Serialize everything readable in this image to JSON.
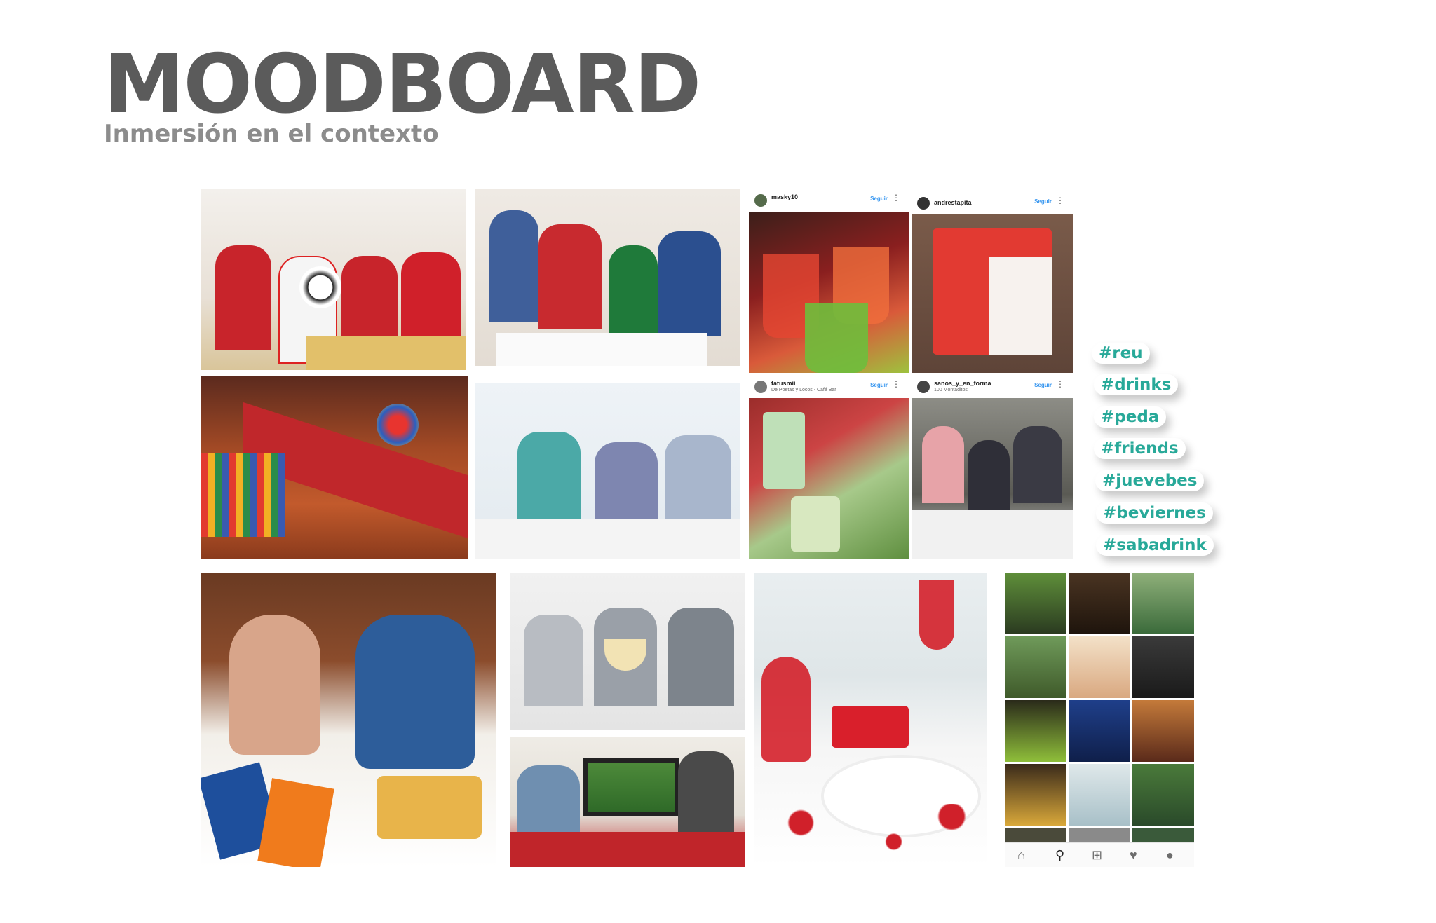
{
  "header": {
    "title": "MOODBOARD",
    "subtitle": "Inmersión en el contexto"
  },
  "instagram_posts": [
    {
      "user": "masky10",
      "sub": "",
      "follow": "Seguir"
    },
    {
      "user": "andrestapita",
      "sub": "",
      "follow": "Seguir"
    },
    {
      "user": "tatusmii",
      "sub": "De Poetas y Locos - Café Bar",
      "follow": "Seguir"
    },
    {
      "user": "sanos_y_en_forma",
      "sub": "100 Montaditos",
      "follow": "Seguir"
    }
  ],
  "hashtags": [
    "#reu",
    "#drinks",
    "#peda",
    "#friends",
    "#juevebes",
    "#beviernes",
    "#sabadrink"
  ],
  "icons": {
    "home": "home-icon",
    "search": "search-icon",
    "add": "add-icon",
    "heart": "heart-icon",
    "profile": "profile-icon",
    "more": "more-icon"
  },
  "colors": {
    "title": "#5b5b5b",
    "subtitle": "#8c8c8c",
    "hashtag": "#28a999",
    "follow": "#3897f0"
  }
}
